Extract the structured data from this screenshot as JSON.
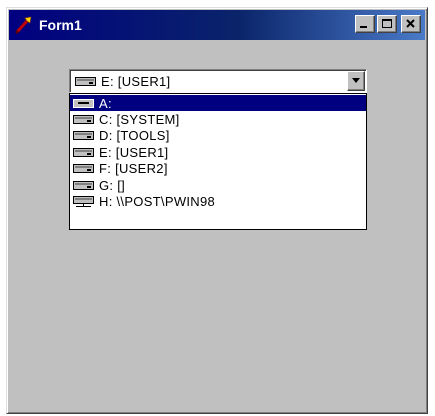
{
  "window": {
    "title": "Form1",
    "buttons": [
      "minimize-icon",
      "maximize-icon",
      "close-icon"
    ]
  },
  "combo": {
    "selected": "E: [USER1]",
    "icon": "drive-icon"
  },
  "dropdown": {
    "items": [
      {
        "label": "A:",
        "icon": "floppy-drive-icon",
        "selected": true
      },
      {
        "label": "C: [SYSTEM]",
        "icon": "hard-drive-icon",
        "selected": false
      },
      {
        "label": "D: [TOOLS]",
        "icon": "hard-drive-icon",
        "selected": false
      },
      {
        "label": "E: [USER1]",
        "icon": "hard-drive-icon",
        "selected": false
      },
      {
        "label": "F: [USER2]",
        "icon": "hard-drive-icon",
        "selected": false
      },
      {
        "label": "G: []",
        "icon": "hard-drive-icon",
        "selected": false
      },
      {
        "label": "H: \\\\POST\\PWIN98",
        "icon": "network-drive-icon",
        "selected": false
      }
    ]
  },
  "colors": {
    "titlebar_start": "#000080",
    "titlebar_end": "#4a7ac8",
    "face": "#c0c0c0",
    "selection": "#000080"
  }
}
